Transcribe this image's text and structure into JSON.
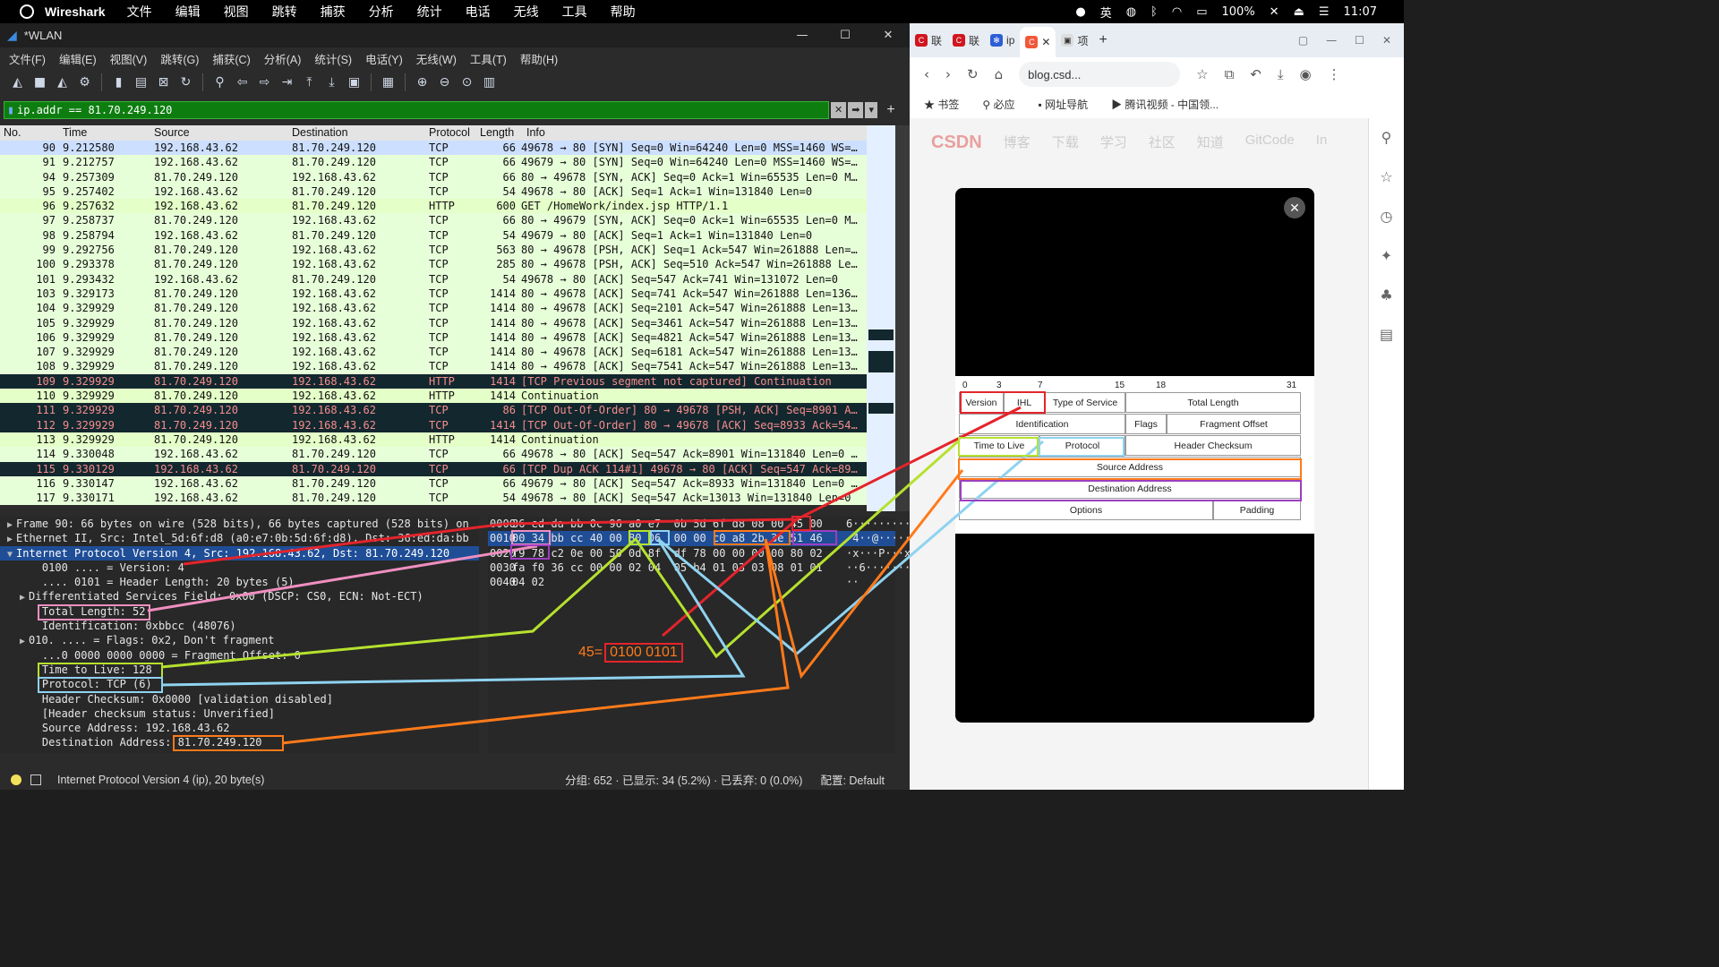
{
  "macbar": {
    "app": "Wireshark",
    "menu": [
      "文件",
      "编辑",
      "视图",
      "跳转",
      "捕获",
      "分析",
      "统计",
      "电话",
      "无线",
      "工具",
      "帮助"
    ],
    "ime": "英",
    "battery": "100%",
    "time": "11:07"
  },
  "ws": {
    "title": "*WLAN",
    "menu": [
      "文件(F)",
      "编辑(E)",
      "视图(V)",
      "跳转(G)",
      "捕获(C)",
      "分析(A)",
      "统计(S)",
      "电话(Y)",
      "无线(W)",
      "工具(T)",
      "帮助(H)"
    ],
    "filter": "ip.addr == 81.70.249.120",
    "columns": [
      "No.",
      "Time",
      "Source",
      "Destination",
      "Protocol",
      "Length",
      "Info"
    ],
    "packets": [
      {
        "no": "90",
        "time": "9.212580",
        "src": "192.168.43.62",
        "dst": "81.70.249.120",
        "proto": "TCP",
        "len": "66",
        "info": "49678 → 80 [SYN] Seq=0 Win=64240 Len=0 MSS=1460 WS=…",
        "style": "r-sel"
      },
      {
        "no": "91",
        "time": "9.212757",
        "src": "192.168.43.62",
        "dst": "81.70.249.120",
        "proto": "TCP",
        "len": "66",
        "info": "49679 → 80 [SYN] Seq=0 Win=64240 Len=0 MSS=1460 WS=…",
        "style": "r-tcp"
      },
      {
        "no": "94",
        "time": "9.257309",
        "src": "81.70.249.120",
        "dst": "192.168.43.62",
        "proto": "TCP",
        "len": "66",
        "info": "80 → 49678 [SYN, ACK] Seq=0 Ack=1 Win=65535 Len=0 M…",
        "style": "r-tcp"
      },
      {
        "no": "95",
        "time": "9.257402",
        "src": "192.168.43.62",
        "dst": "81.70.249.120",
        "proto": "TCP",
        "len": "54",
        "info": "49678 → 80 [ACK] Seq=1 Ack=1 Win=131840 Len=0",
        "style": "r-tcp"
      },
      {
        "no": "96",
        "time": "9.257632",
        "src": "192.168.43.62",
        "dst": "81.70.249.120",
        "proto": "HTTP",
        "len": "600",
        "info": "GET /HomeWork/index.jsp HTTP/1.1",
        "style": "r-http"
      },
      {
        "no": "97",
        "time": "9.258737",
        "src": "81.70.249.120",
        "dst": "192.168.43.62",
        "proto": "TCP",
        "len": "66",
        "info": "80 → 49679 [SYN, ACK] Seq=0 Ack=1 Win=65535 Len=0 M…",
        "style": "r-tcp"
      },
      {
        "no": "98",
        "time": "9.258794",
        "src": "192.168.43.62",
        "dst": "81.70.249.120",
        "proto": "TCP",
        "len": "54",
        "info": "49679 → 80 [ACK] Seq=1 Ack=1 Win=131840 Len=0",
        "style": "r-tcp"
      },
      {
        "no": "99",
        "time": "9.292756",
        "src": "81.70.249.120",
        "dst": "192.168.43.62",
        "proto": "TCP",
        "len": "563",
        "info": "80 → 49678 [PSH, ACK] Seq=1 Ack=547 Win=261888 Len=…",
        "style": "r-tcp"
      },
      {
        "no": "100",
        "time": "9.293378",
        "src": "81.70.249.120",
        "dst": "192.168.43.62",
        "proto": "TCP",
        "len": "285",
        "info": "80 → 49678 [PSH, ACK] Seq=510 Ack=547 Win=261888 Le…",
        "style": "r-tcp"
      },
      {
        "no": "101",
        "time": "9.293432",
        "src": "192.168.43.62",
        "dst": "81.70.249.120",
        "proto": "TCP",
        "len": "54",
        "info": "49678 → 80 [ACK] Seq=547 Ack=741 Win=131072 Len=0",
        "style": "r-tcp"
      },
      {
        "no": "103",
        "time": "9.329173",
        "src": "81.70.249.120",
        "dst": "192.168.43.62",
        "proto": "TCP",
        "len": "1414",
        "info": "80 → 49678 [ACK] Seq=741 Ack=547 Win=261888 Len=136…",
        "style": "r-tcp"
      },
      {
        "no": "104",
        "time": "9.329929",
        "src": "81.70.249.120",
        "dst": "192.168.43.62",
        "proto": "TCP",
        "len": "1414",
        "info": "80 → 49678 [ACK] Seq=2101 Ack=547 Win=261888 Len=13…",
        "style": "r-tcp"
      },
      {
        "no": "105",
        "time": "9.329929",
        "src": "81.70.249.120",
        "dst": "192.168.43.62",
        "proto": "TCP",
        "len": "1414",
        "info": "80 → 49678 [ACK] Seq=3461 Ack=547 Win=261888 Len=13…",
        "style": "r-tcp"
      },
      {
        "no": "106",
        "time": "9.329929",
        "src": "81.70.249.120",
        "dst": "192.168.43.62",
        "proto": "TCP",
        "len": "1414",
        "info": "80 → 49678 [ACK] Seq=4821 Ack=547 Win=261888 Len=13…",
        "style": "r-tcp"
      },
      {
        "no": "107",
        "time": "9.329929",
        "src": "81.70.249.120",
        "dst": "192.168.43.62",
        "proto": "TCP",
        "len": "1414",
        "info": "80 → 49678 [ACK] Seq=6181 Ack=547 Win=261888 Len=13…",
        "style": "r-tcp"
      },
      {
        "no": "108",
        "time": "9.329929",
        "src": "81.70.249.120",
        "dst": "192.168.43.62",
        "proto": "TCP",
        "len": "1414",
        "info": "80 → 49678 [ACK] Seq=7541 Ack=547 Win=261888 Len=13…",
        "style": "r-tcp"
      },
      {
        "no": "109",
        "time": "9.329929",
        "src": "81.70.249.120",
        "dst": "192.168.43.62",
        "proto": "HTTP",
        "len": "1414",
        "info": "[TCP Previous segment not captured] Continuation",
        "style": "r-bad"
      },
      {
        "no": "110",
        "time": "9.329929",
        "src": "81.70.249.120",
        "dst": "192.168.43.62",
        "proto": "HTTP",
        "len": "1414",
        "info": "Continuation",
        "style": "r-http"
      },
      {
        "no": "111",
        "time": "9.329929",
        "src": "81.70.249.120",
        "dst": "192.168.43.62",
        "proto": "TCP",
        "len": "86",
        "info": "[TCP Out-Of-Order] 80 → 49678 [PSH, ACK] Seq=8901 A…",
        "style": "r-bad"
      },
      {
        "no": "112",
        "time": "9.329929",
        "src": "81.70.249.120",
        "dst": "192.168.43.62",
        "proto": "TCP",
        "len": "1414",
        "info": "[TCP Out-Of-Order] 80 → 49678 [ACK] Seq=8933 Ack=54…",
        "style": "r-bad"
      },
      {
        "no": "113",
        "time": "9.329929",
        "src": "81.70.249.120",
        "dst": "192.168.43.62",
        "proto": "HTTP",
        "len": "1414",
        "info": "Continuation",
        "style": "r-http"
      },
      {
        "no": "114",
        "time": "9.330048",
        "src": "192.168.43.62",
        "dst": "81.70.249.120",
        "proto": "TCP",
        "len": "66",
        "info": "49678 → 80 [ACK] Seq=547 Ack=8901 Win=131840 Len=0 …",
        "style": "r-tcp"
      },
      {
        "no": "115",
        "time": "9.330129",
        "src": "192.168.43.62",
        "dst": "81.70.249.120",
        "proto": "TCP",
        "len": "66",
        "info": "[TCP Dup ACK 114#1] 49678 → 80 [ACK] Seq=547 Ack=89…",
        "style": "r-bad"
      },
      {
        "no": "116",
        "time": "9.330147",
        "src": "192.168.43.62",
        "dst": "81.70.249.120",
        "proto": "TCP",
        "len": "66",
        "info": "49679 → 80 [ACK] Seq=547 Ack=8933 Win=131840 Len=0 …",
        "style": "r-tcp"
      },
      {
        "no": "117",
        "time": "9.330171",
        "src": "192.168.43.62",
        "dst": "81.70.249.120",
        "proto": "TCP",
        "len": "54",
        "info": "49678 → 80 [ACK] Seq=547 Ack=13013 Win=131840 Len=0",
        "style": "r-tcp"
      }
    ],
    "details": [
      {
        "tw": "▶",
        "text": "Frame 90: 66 bytes on wire (528 bits), 66 bytes captured (528 bits) on"
      },
      {
        "tw": "▶",
        "text": "Ethernet II, Src: Intel_5d:6f:d8 (a0:e7:0b:5d:6f:d8), Dst: 36:ed:da:bb"
      },
      {
        "tw": "▼",
        "text": "Internet Protocol Version 4, Src: 192.168.43.62, Dst: 81.70.249.120",
        "sel": true
      },
      {
        "tw": "",
        "text": "    0100 .... = Version: 4"
      },
      {
        "tw": "",
        "text": "    .... 0101 = Header Length: 20 bytes (5)"
      },
      {
        "tw": "  ▶",
        "text": "Differentiated Services Field: 0x00 (DSCP: CS0, ECN: Not-ECT)"
      },
      {
        "tw": "",
        "text": "    Total Length: 52"
      },
      {
        "tw": "",
        "text": "    Identification: 0xbbcc (48076)"
      },
      {
        "tw": "  ▶",
        "text": "010. .... = Flags: 0x2, Don't fragment"
      },
      {
        "tw": "",
        "text": "    ...0 0000 0000 0000 = Fragment Offset: 0"
      },
      {
        "tw": "",
        "text": "    Time to Live: 128"
      },
      {
        "tw": "",
        "text": "    Protocol: TCP (6)"
      },
      {
        "tw": "",
        "text": "    Header Checksum: 0x0000 [validation disabled]"
      },
      {
        "tw": "",
        "text": "    [Header checksum status: Unverified]"
      },
      {
        "tw": "",
        "text": "    Source Address: 192.168.43.62"
      },
      {
        "tw": "",
        "text": "    Destination Address: 81.70.249.120"
      }
    ],
    "bytes": [
      {
        "off": "0000",
        "hex": "36 ed da bb 0c 96 a0 e7  0b 5d 6f d8 08 00 45 00",
        "ascii": "6··········]o···E·"
      },
      {
        "off": "0010",
        "hex": "00 34 bb cc 40 00 80 06  00 00 c0 a8 2b 3e 51 46",
        "ascii": "·4··@·······+>QF",
        "sel": true
      },
      {
        "off": "0020",
        "hex": "f9 78 c2 0e 00 50 0d 8f  df 78 00 00 00 00 80 02",
        "ascii": "·x···P···x······"
      },
      {
        "off": "0030",
        "hex": "fa f0 36 cc 00 00 02 04  05 b4 01 03 03 08 01 01",
        "ascii": "··6·············"
      },
      {
        "off": "0040",
        "hex": "04 02",
        "ascii": "··"
      }
    ],
    "status_proto": "Internet Protocol Version 4 (ip), 20 byte(s)",
    "status_counts": "分组: 652 · 已显示: 34 (5.2%) · 已丢弃: 0 (0.0%)",
    "status_profile": "配置: Default",
    "annotation_45": "45=",
    "annotation_bits": "0100 0101"
  },
  "browser": {
    "tabs": [
      "联",
      "联",
      "ip",
      "",
      "项"
    ],
    "url": "blog.csd...",
    "bookmarks": [
      "书签",
      "必应",
      "网址导航",
      "腾讯视频 - 中国领..."
    ],
    "csdn_nav": [
      "CSDN",
      "博客",
      "下载",
      "学习",
      "社区",
      "知道",
      "GitCode",
      "In"
    ]
  },
  "ipheader": {
    "bits": [
      "0",
      "3",
      "7",
      "15",
      "18",
      "31"
    ],
    "fields": {
      "version": "Version",
      "ihl": "IHL",
      "tos": "Type of Service",
      "total": "Total Length",
      "ident": "Identification",
      "flags": "Flags",
      "frag": "Fragment Offset",
      "ttl": "Time to Live",
      "proto": "Protocol",
      "cksum": "Header Checksum",
      "src": "Source Address",
      "dst": "Destination Address",
      "options": "Options",
      "padding": "Padding"
    }
  },
  "colors": {
    "red": "#e4242b",
    "pink": "#ef8fc0",
    "yellowgreen": "#b6e12e",
    "cyan": "#8fd3f0",
    "orange": "#ff7a1a",
    "purple": "#9b3fc0",
    "filter_green": "#0d7d10"
  }
}
